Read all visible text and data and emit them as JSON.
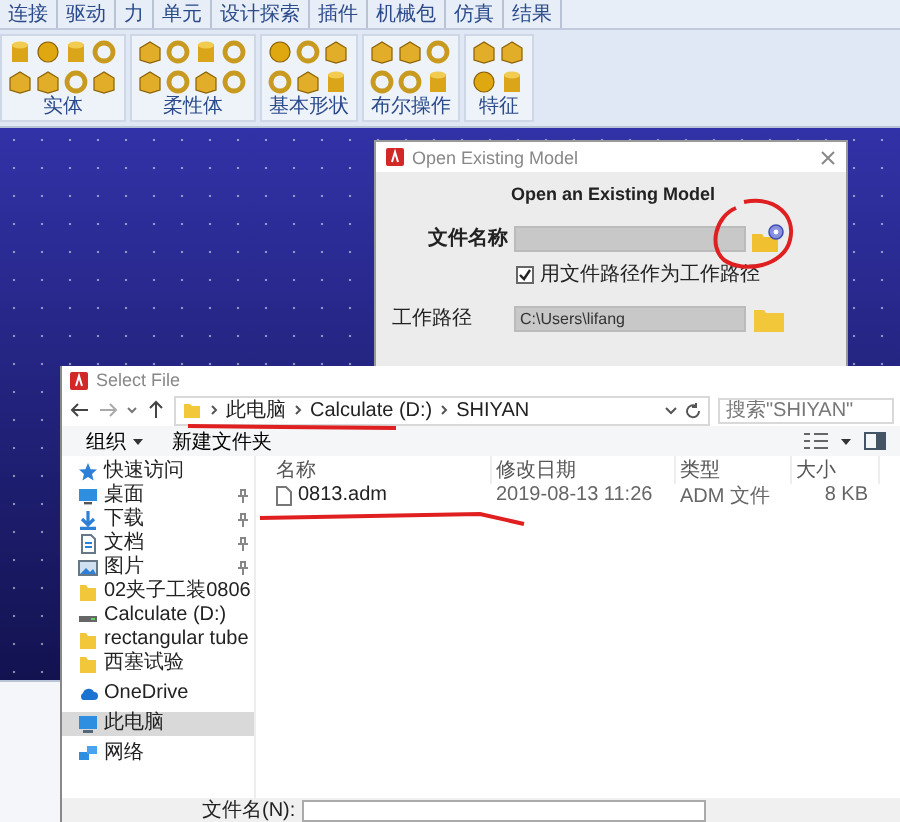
{
  "ribbon": {
    "tabs": [
      {
        "label": "连接",
        "selected": false
      },
      {
        "label": "驱动",
        "selected": false
      },
      {
        "label": "力",
        "selected": false
      },
      {
        "label": "单元",
        "selected": false
      },
      {
        "label": "设计探索",
        "selected": false
      },
      {
        "label": "插件",
        "selected": false
      },
      {
        "label": "机械包",
        "selected": false
      },
      {
        "label": "仿真",
        "selected": false
      },
      {
        "label": "结果",
        "selected": false
      }
    ],
    "groups": [
      {
        "label": "实体"
      },
      {
        "label": "柔性体"
      },
      {
        "label": "基本形状"
      },
      {
        "label": "布尔操作"
      },
      {
        "label": "特征"
      }
    ]
  },
  "model_dialog": {
    "title": "Open Existing Model",
    "heading": "Open an Existing Model",
    "file_label": "文件名称",
    "use_path": {
      "label": "用文件路径作为工作路径",
      "checked": true
    },
    "workdir_label": "工作路径",
    "workdir_value": "C:\\Users\\lifang"
  },
  "file_dialog": {
    "title": "Select File",
    "breadcrumb": [
      "此电脑",
      "Calculate (D:)",
      "SHIYAN"
    ],
    "search": {
      "placeholder": "搜索\"SHIYAN\""
    },
    "organize": "组织",
    "new_folder": "新建文件夹",
    "sidebar": [
      {
        "label": "快速访问",
        "kind": "quick",
        "pinned": false,
        "selected": false
      },
      {
        "label": "桌面",
        "kind": "desktop",
        "pinned": true,
        "selected": false
      },
      {
        "label": "下载",
        "kind": "download",
        "pinned": true,
        "selected": false
      },
      {
        "label": "文档",
        "kind": "doc",
        "pinned": true,
        "selected": false
      },
      {
        "label": "图片",
        "kind": "picture",
        "pinned": true,
        "selected": false
      },
      {
        "label": "02夹子工装0806",
        "kind": "folder",
        "pinned": false,
        "selected": false
      },
      {
        "label": "Calculate (D:)",
        "kind": "drive",
        "pinned": false,
        "selected": false
      },
      {
        "label": "rectangular tube",
        "kind": "folder",
        "pinned": false,
        "selected": false
      },
      {
        "label": "西塞试验",
        "kind": "folder",
        "pinned": false,
        "selected": false
      },
      {
        "label": "OneDrive",
        "kind": "cloud",
        "pinned": false,
        "selected": false
      },
      {
        "label": "此电脑",
        "kind": "pc",
        "pinned": false,
        "selected": true
      },
      {
        "label": "网络",
        "kind": "network",
        "pinned": false,
        "selected": false
      }
    ],
    "columns": [
      "名称",
      "修改日期",
      "类型",
      "大小"
    ],
    "rows": [
      {
        "cells": [
          "0813.adm",
          "2019-08-13 11:26",
          "ADM 文件",
          "8 KB"
        ],
        "selected": false
      }
    ],
    "filename_label": "文件名(N):"
  }
}
